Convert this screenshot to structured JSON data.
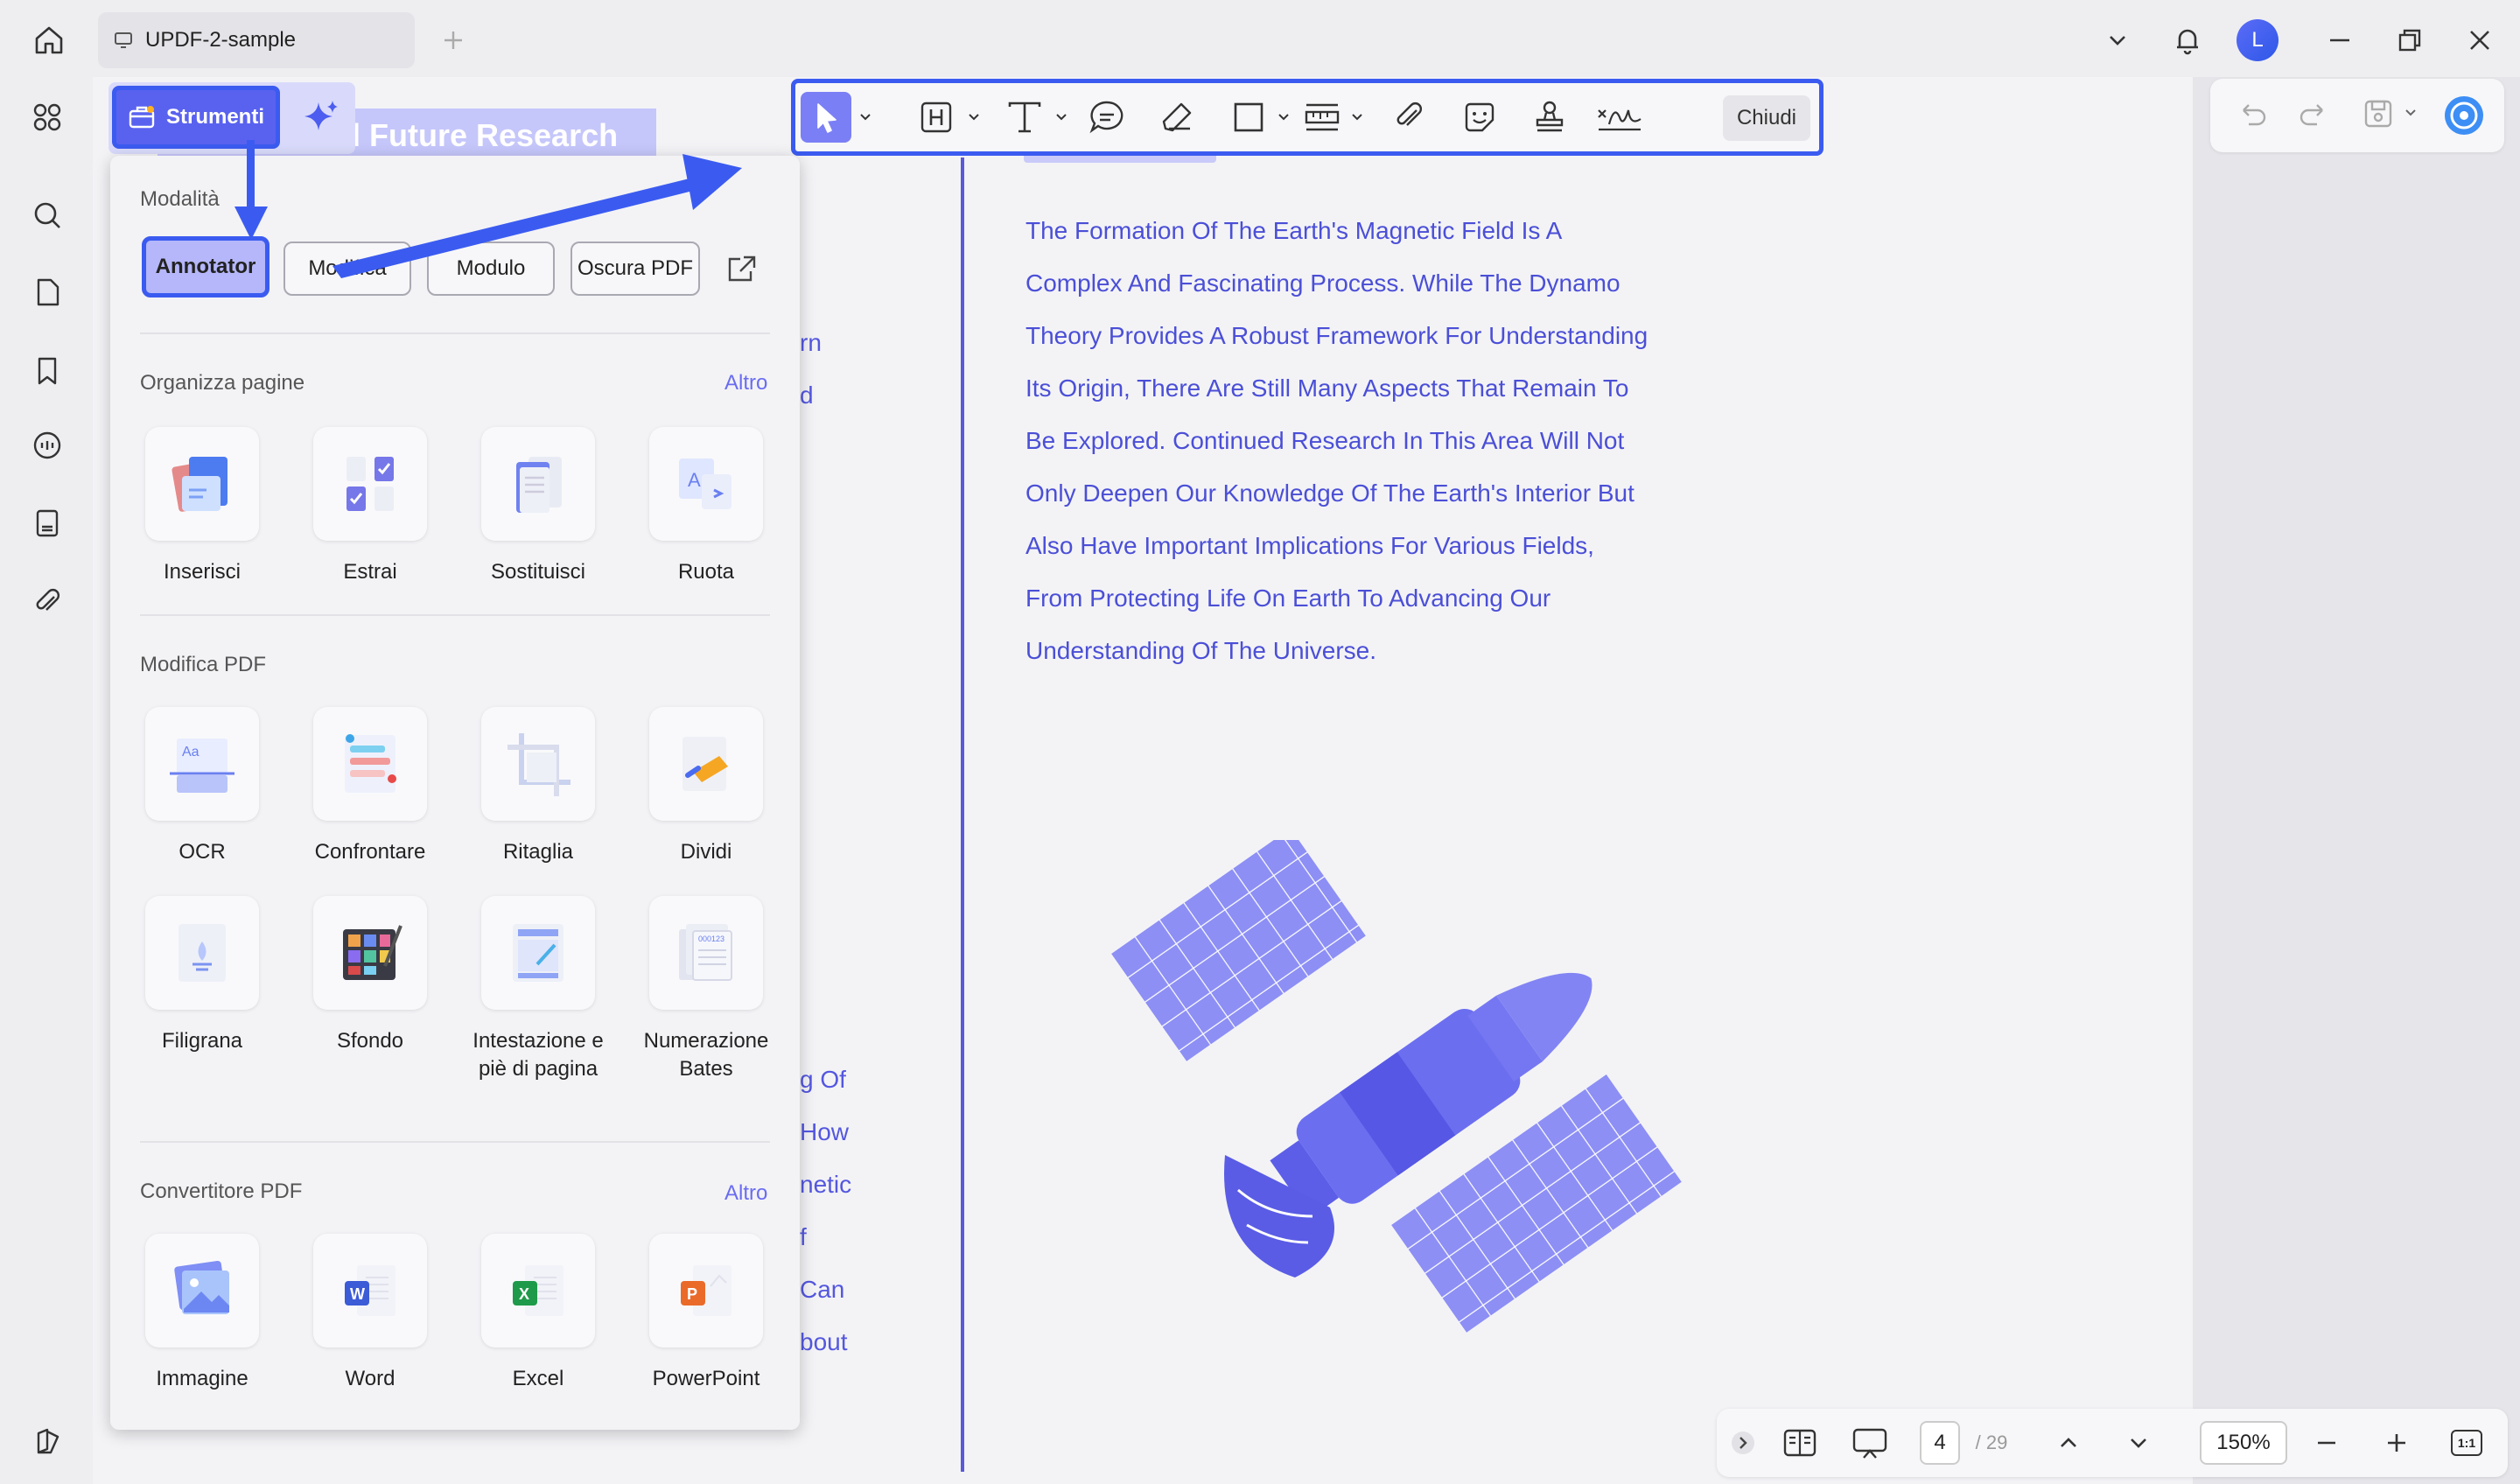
{
  "tab": {
    "title": "UPDF-2-sample"
  },
  "user": {
    "initial": "L"
  },
  "document": {
    "heading_fragment": "d Future Research",
    "paragraph": [
      "The Formation Of The Earth's Magnetic Field Is A",
      "Complex And Fascinating Process. While The Dynamo",
      "Theory Provides A Robust Framework For Understanding",
      "Its Origin, There Are Still Many Aspects That Remain To",
      "Be Explored. Continued Research In This Area Will Not",
      "Only Deepen Our Knowledge Of The Earth's Interior But",
      "Also Have Important Implications For Various Fields,",
      "From Protecting Life On Earth To Advancing Our",
      "Understanding Of The Universe."
    ],
    "left_page_fragments": [
      "rn",
      "d",
      "g Of",
      "How",
      "netic",
      "f",
      "Can",
      "bout"
    ]
  },
  "toolbar": {
    "close_label": "Chiudi",
    "tools": [
      "select-icon",
      "highlight-icon",
      "text-icon",
      "comment-icon",
      "pencil-icon",
      "rectangle-icon",
      "measure-icon",
      "attach-icon",
      "sticker-icon",
      "stamp-icon",
      "signature-icon"
    ]
  },
  "strumenti": {
    "label": "Strumenti"
  },
  "panel": {
    "modes_title": "Modalità",
    "modes": [
      "Annotator",
      "Modifica",
      "Modulo",
      "Oscura PDF"
    ],
    "organize": {
      "title": "Organizza pagine",
      "more": "Altro",
      "items": [
        "Inserisci",
        "Estrai",
        "Sostituisci",
        "Ruota"
      ]
    },
    "edit": {
      "title": "Modifica PDF",
      "items": [
        "OCR",
        "Confrontare",
        "Ritaglia",
        "Dividi",
        "Filigrana",
        "Sfondo",
        "Intestazione e piè di pagina",
        "Numerazione Bates"
      ]
    },
    "convert": {
      "title": "Convertitore PDF",
      "more": "Altro",
      "items": [
        "Immagine",
        "Word",
        "Excel",
        "PowerPoint"
      ]
    }
  },
  "navigation": {
    "current_page": "4",
    "total_pages": "/ 29",
    "zoom": "150%",
    "fit_label": "1:1"
  },
  "colors": {
    "accent": "#3b5bf0",
    "text_purple": "#4b4fd6",
    "satellite": "#8a8cf5"
  }
}
